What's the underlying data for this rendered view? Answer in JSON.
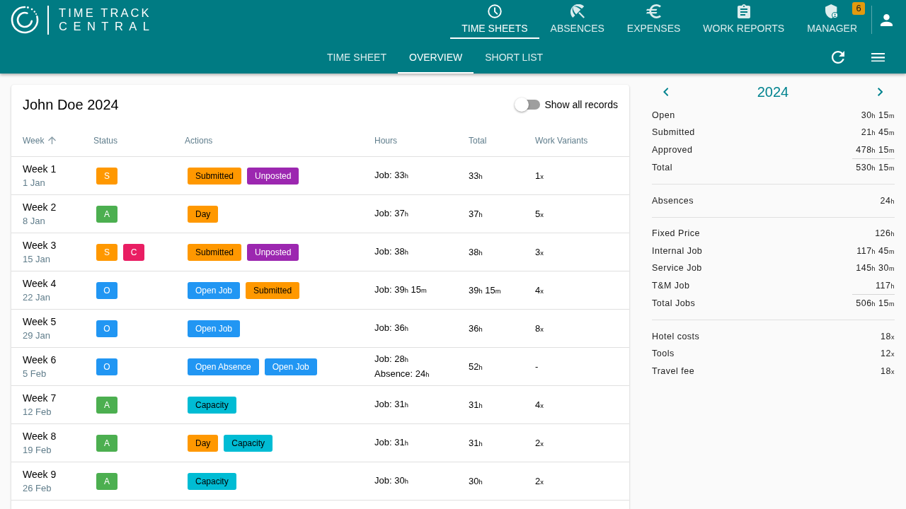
{
  "header": {
    "logo_lines": [
      "TIME TRACK",
      "CENTRAL"
    ],
    "nav": [
      {
        "label": "TIME SHEETS",
        "kind": "clock",
        "selected": true
      },
      {
        "label": "ABSENCES",
        "kind": "umbrella",
        "selected": false
      },
      {
        "label": "EXPENSES",
        "kind": "euro",
        "selected": false
      },
      {
        "label": "WORK REPORTS",
        "kind": "clipboard",
        "selected": false
      },
      {
        "label": "MANAGER",
        "kind": "shield",
        "selected": false,
        "badge": "6"
      }
    ]
  },
  "subnav": {
    "tabs": [
      {
        "label": "TIME SHEET",
        "selected": false
      },
      {
        "label": "OVERVIEW",
        "selected": true
      },
      {
        "label": "SHORT LIST",
        "selected": false
      }
    ]
  },
  "card": {
    "title": "John Doe 2024",
    "toggle": {
      "label": "Show all records",
      "on": false
    },
    "table": {
      "columns": [
        {
          "label": "Week",
          "sorted": true
        },
        {
          "label": "Status",
          "sorted": false
        },
        {
          "label": "Actions",
          "sorted": false
        },
        {
          "label": "Hours",
          "sorted": false
        },
        {
          "label": "Total",
          "sorted": false
        },
        {
          "label": "Work Variants",
          "sorted": false
        }
      ],
      "rows": [
        {
          "week": "Week 1",
          "date": "1 Jan",
          "statuses": [
            {
              "label": "S",
              "color": "#ff9800"
            }
          ],
          "actions": [
            {
              "label": "Submitted",
              "color": "#ff9800"
            },
            {
              "label": "Unposted",
              "color": "#9c27b0"
            }
          ],
          "hours": [
            "Job: 33$_{h}$"
          ],
          "total": "33$_{h}$",
          "variants": "1$_{x}$"
        },
        {
          "week": "Week 2",
          "date": "8 Jan",
          "statuses": [
            {
              "label": "A",
              "color": "#4caf50"
            }
          ],
          "actions": [
            {
              "label": "Day",
              "color": "#ff9800"
            }
          ],
          "hours": [
            "Job: 37$_{h}$"
          ],
          "total": "37$_{h}$",
          "variants": "5$_{x}$"
        },
        {
          "week": "Week 3",
          "date": "15 Jan",
          "statuses": [
            {
              "label": "S",
              "color": "#ff9800"
            },
            {
              "label": "C",
              "color": "#e91e63"
            }
          ],
          "actions": [
            {
              "label": "Submitted",
              "color": "#ff9800"
            },
            {
              "label": "Unposted",
              "color": "#9c27b0"
            }
          ],
          "hours": [
            "Job: 38$_{h}$"
          ],
          "total": "38$_{h}$",
          "variants": "3$_{x}$"
        },
        {
          "week": "Week 4",
          "date": "22 Jan",
          "statuses": [
            {
              "label": "O",
              "color": "#2196f3"
            }
          ],
          "actions": [
            {
              "label": "Open Job",
              "color": "#2196f3"
            },
            {
              "label": "Submitted",
              "color": "#ff9800"
            }
          ],
          "hours": [
            "Job: 39$_{h}$ 15$_{m}$"
          ],
          "total": "39$_{h}$ 15$_{m}$",
          "variants": "4$_{x}$"
        },
        {
          "week": "Week 5",
          "date": "29 Jan",
          "statuses": [
            {
              "label": "O",
              "color": "#2196f3"
            }
          ],
          "actions": [
            {
              "label": "Open Job",
              "color": "#2196f3"
            }
          ],
          "hours": [
            "Job: 36$_{h}$"
          ],
          "total": "36$_{h}$",
          "variants": "8$_{x}$"
        },
        {
          "week": "Week 6",
          "date": "5 Feb",
          "statuses": [
            {
              "label": "O",
              "color": "#2196f3"
            }
          ],
          "actions": [
            {
              "label": "Open Absence",
              "color": "#2196f3"
            },
            {
              "label": "Open Job",
              "color": "#2196f3"
            }
          ],
          "hours": [
            "Job: 28$_{h}$",
            "Absence: 24$_{h}$"
          ],
          "total": "52$_{h}$",
          "variants": "-"
        },
        {
          "week": "Week 7",
          "date": "12 Feb",
          "statuses": [
            {
              "label": "A",
              "color": "#4caf50"
            }
          ],
          "actions": [
            {
              "label": "Capacity",
              "color": "#00bcd4"
            }
          ],
          "hours": [
            "Job: 31$_{h}$"
          ],
          "total": "31$_{h}$",
          "variants": "4$_{x}$"
        },
        {
          "week": "Week 8",
          "date": "19 Feb",
          "statuses": [
            {
              "label": "A",
              "color": "#4caf50"
            }
          ],
          "actions": [
            {
              "label": "Day",
              "color": "#ff9800"
            },
            {
              "label": "Capacity",
              "color": "#00bcd4"
            }
          ],
          "hours": [
            "Job: 31$_{h}$"
          ],
          "total": "31$_{h}$",
          "variants": "2$_{x}$"
        },
        {
          "week": "Week 9",
          "date": "26 Feb",
          "statuses": [
            {
              "label": "A",
              "color": "#4caf50"
            }
          ],
          "actions": [
            {
              "label": "Capacity",
              "color": "#00bcd4"
            }
          ],
          "hours": [
            "Job: 30$_{h}$"
          ],
          "total": "30$_{h}$",
          "variants": "2$_{x}$"
        }
      ]
    }
  },
  "summary": {
    "year": "2024",
    "groups": [
      {
        "rows": [
          {
            "kind": "item",
            "label": "Open",
            "value": "30$_{h}$ 15$_{m}$"
          },
          {
            "kind": "item",
            "label": "Submitted",
            "value": "21$_{h}$ 45$_{m}$"
          },
          {
            "kind": "item",
            "label": "Approved",
            "value": "478$_{h}$ 15$_{m}$"
          },
          {
            "kind": "total",
            "label": "Total",
            "value": "530$_{h}$ 15$_{m}$"
          }
        ]
      },
      {
        "rows": [
          {
            "kind": "item",
            "label": "Absences",
            "value": "24$_{h}$"
          }
        ]
      },
      {
        "rows": [
          {
            "kind": "item",
            "label": "Fixed Price",
            "value": "126$_{h}$"
          },
          {
            "kind": "item",
            "label": "Internal Job",
            "value": "117$_{h}$ 45$_{m}$"
          },
          {
            "kind": "item",
            "label": "Service Job",
            "value": "145$_{h}$ 30$_{m}$"
          },
          {
            "kind": "item",
            "label": "T&M Job",
            "value": "117$_{h}$"
          },
          {
            "kind": "total",
            "label": "Total Jobs",
            "value": "506$_{h}$ 15$_{m}$"
          }
        ]
      },
      {
        "rows": [
          {
            "kind": "item",
            "label": "Hotel costs",
            "value": "18$_{x}$"
          },
          {
            "kind": "item",
            "label": "Tools",
            "value": "12$_{x}$"
          },
          {
            "kind": "item",
            "label": "Travel fee",
            "value": "18$_{x}$"
          }
        ]
      }
    ]
  }
}
